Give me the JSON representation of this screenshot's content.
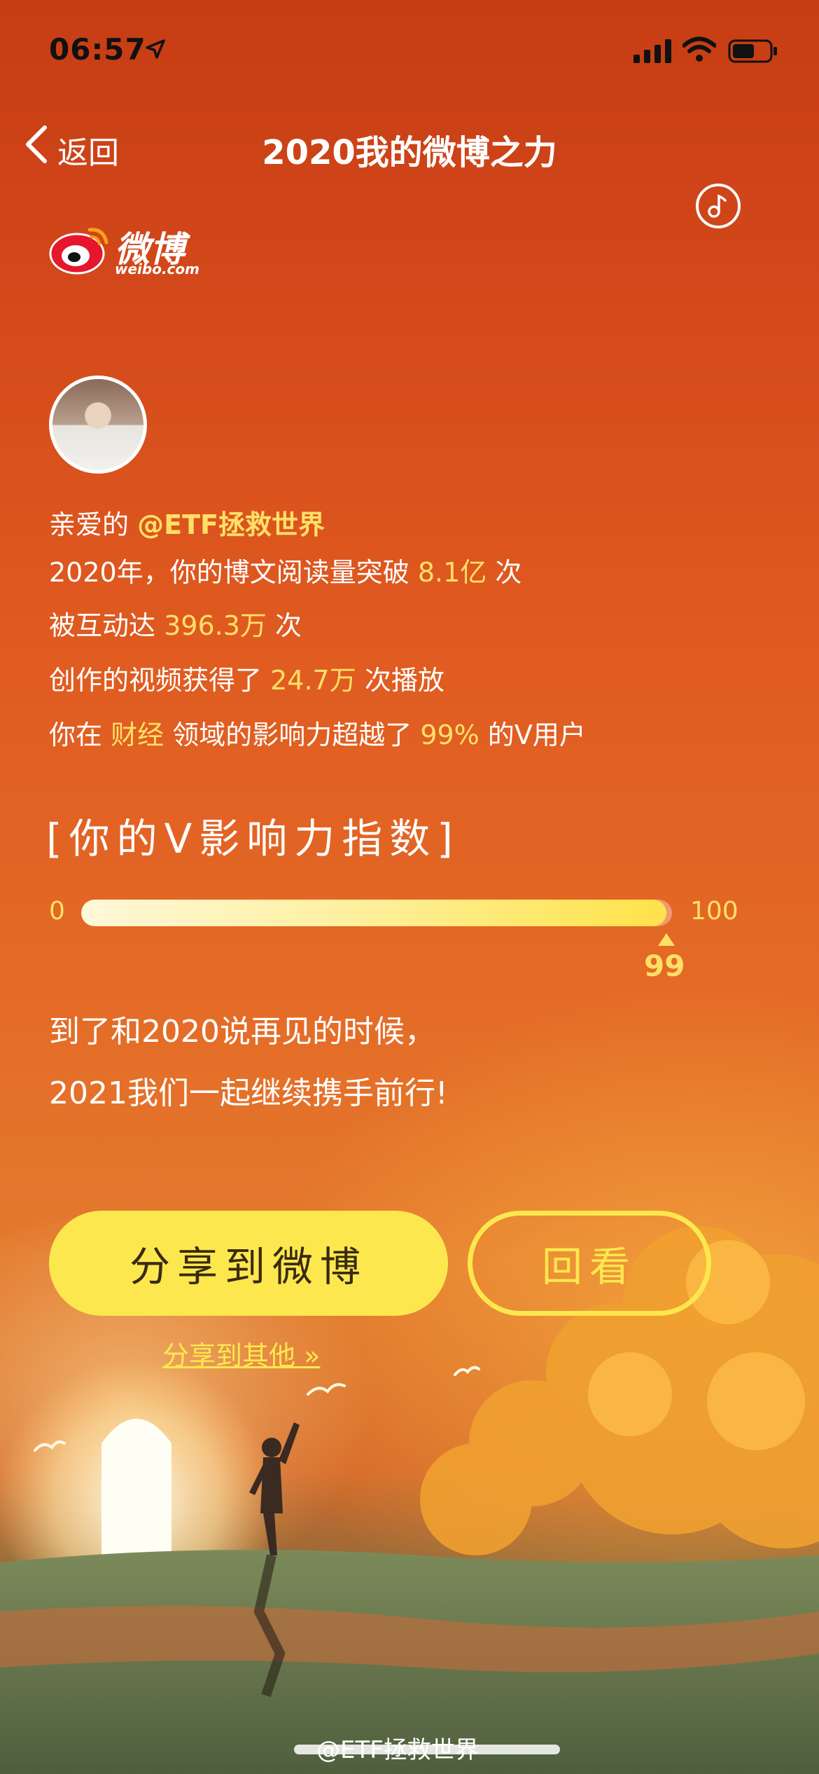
{
  "status_bar": {
    "time": "06:57"
  },
  "nav": {
    "back_label": "返回",
    "title": "2020我的微博之力"
  },
  "logo": {
    "text": "微博",
    "domain": "weibo.com"
  },
  "summary": {
    "greeting_prefix": "亲爱的",
    "username": "@ETF拯救世界",
    "reads_prefix": "2020年，你的博文阅读量突破",
    "reads_value": "8.1亿",
    "reads_suffix": "次",
    "interactions_prefix": "被互动达",
    "interactions_value": "396.3万",
    "interactions_suffix": "次",
    "video_prefix": "创作的视频获得了",
    "video_value": "24.7万",
    "video_suffix": "次播放",
    "domain_prefix": "你在",
    "domain_value": "财经",
    "domain_middle": "领域的影响力超越了",
    "domain_percent": "99%",
    "domain_suffix": "的V用户"
  },
  "influence": {
    "title": "[你的V影响力指数]",
    "min_label": "0",
    "max_label": "100",
    "value": 99,
    "value_label": "99"
  },
  "farewell": {
    "line1": "到了和2020说再见的时候，",
    "line2": "2021我们一起继续携手前行!"
  },
  "actions": {
    "share_weibo": "分享到微博",
    "review": "回看",
    "share_other": "分享到其他 »"
  },
  "watermark": "@ETF拯救世界",
  "colors": {
    "highlight": "#ffe066",
    "button": "#fce84e",
    "background_top": "#c63c14",
    "background_mid": "#e46a26"
  },
  "icons": [
    "location-arrow-icon",
    "signal-icon",
    "wifi-icon",
    "battery-icon",
    "back-chevron-icon",
    "music-note-icon",
    "weibo-logo"
  ]
}
